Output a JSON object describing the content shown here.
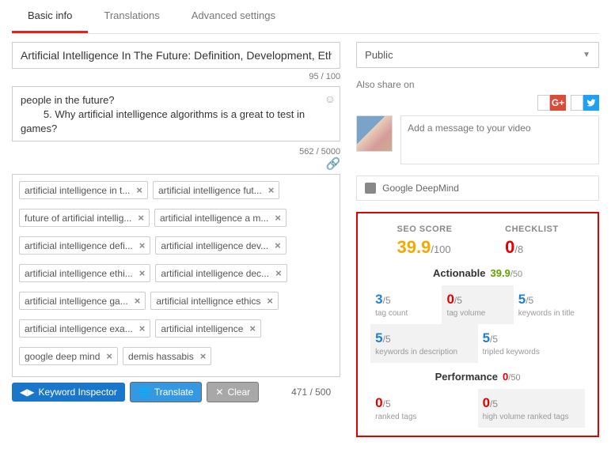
{
  "tabs": {
    "basic": "Basic info",
    "translations": "Translations",
    "advanced": "Advanced settings"
  },
  "title": {
    "value": "Artificial Intelligence In The Future: Definition, Development, Ethical Iss",
    "counter": "95 / 100"
  },
  "description": {
    "text": "people in the future?\n        5. Why artificial intelligence algorithms is a great to test in games?",
    "counter": "562 / 5000"
  },
  "tags": {
    "row1": [
      "artificial intelligence in t...",
      "artificial intelligence fut..."
    ],
    "row2": [
      "future of artificial intellig...",
      "artificial intelligence a m..."
    ],
    "row3": [
      "artificial intelligence defi...",
      "artificial intelligence dev..."
    ],
    "row4": [
      "artificial intelligence ethi...",
      "artificial intelligence dec..."
    ],
    "row5": [
      "artificial intelligence ga...",
      "artificial intellignce ethics"
    ],
    "row6": [
      "artificial intelligence exa...",
      "artificial intelligence"
    ],
    "row7": [
      "google deep mind",
      "demis hassabis"
    ],
    "counter": "471 / 500"
  },
  "buttons": {
    "inspector": "Keyword Inspector",
    "translate": "Translate",
    "clear": "Clear"
  },
  "privacy": {
    "label": "Public"
  },
  "share": {
    "label": "Also share on",
    "placeholder": "Add a message to your video",
    "gplus": "G+",
    "twitter": "t"
  },
  "deepmind": "Google DeepMind",
  "seo": {
    "score": {
      "label": "SEO SCORE",
      "value": "39.9",
      "denom": "/100"
    },
    "checklist": {
      "label": "CHECKLIST",
      "value": "0",
      "denom": "/8"
    },
    "actionable": {
      "label": "Actionable",
      "value": "39.9",
      "denom": "/50"
    },
    "cells": {
      "tag_count": {
        "v": "3",
        "d": "/5",
        "l": "tag count",
        "c": "blue"
      },
      "tag_volume": {
        "v": "0",
        "d": "/5",
        "l": "tag volume",
        "c": "red"
      },
      "kw_title": {
        "v": "5",
        "d": "/5",
        "l": "keywords in title",
        "c": "blue"
      },
      "kw_desc": {
        "v": "5",
        "d": "/5",
        "l": "keywords in description",
        "c": "blue"
      },
      "tripled": {
        "v": "5",
        "d": "/5",
        "l": "tripled keywords",
        "c": "blue"
      }
    },
    "performance": {
      "label": "Performance",
      "value": "0",
      "denom": "/50"
    },
    "pcells": {
      "ranked": {
        "v": "0",
        "d": "/5",
        "l": "ranked tags",
        "c": "red"
      },
      "highvol": {
        "v": "0",
        "d": "/5",
        "l": "high volume ranked tags",
        "c": "red"
      }
    }
  }
}
